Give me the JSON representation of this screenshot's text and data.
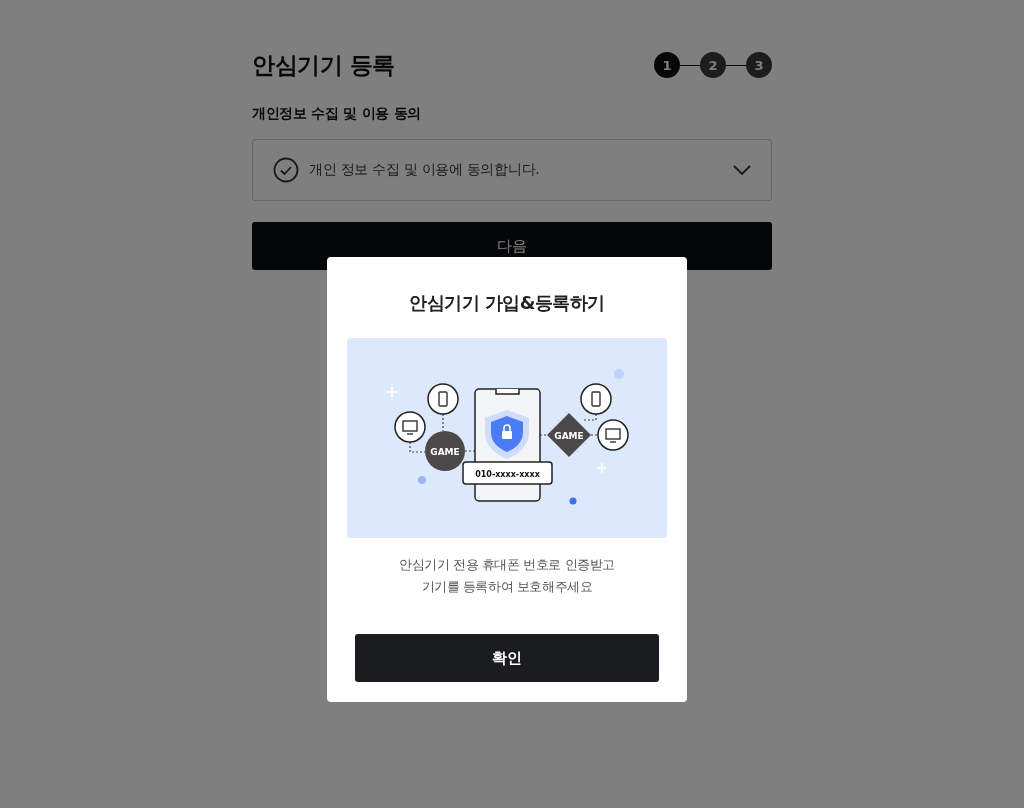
{
  "page": {
    "title": "안심기기 등록",
    "steps": [
      {
        "label": "1",
        "selected": true
      },
      {
        "label": "2",
        "selected": false
      },
      {
        "label": "3",
        "selected": false
      }
    ],
    "section_label": "개인정보 수집 및 이용 동의",
    "agreement": {
      "text": "개인 정보 수집 및 이용에 동의합니다.",
      "checked": false,
      "expanded": false
    },
    "next_button": "다음"
  },
  "dialog": {
    "title": "안심기기 가입&등록하기",
    "illustration": {
      "left_badge": "GAME",
      "right_badge": "GAME",
      "phone_number": "010-xxxx-xxxx"
    },
    "description": [
      "안심기기 전용 휴대폰 번호로 인증받고",
      "기기를 등록하여 보호해주세요"
    ],
    "confirm_button": "확인"
  }
}
